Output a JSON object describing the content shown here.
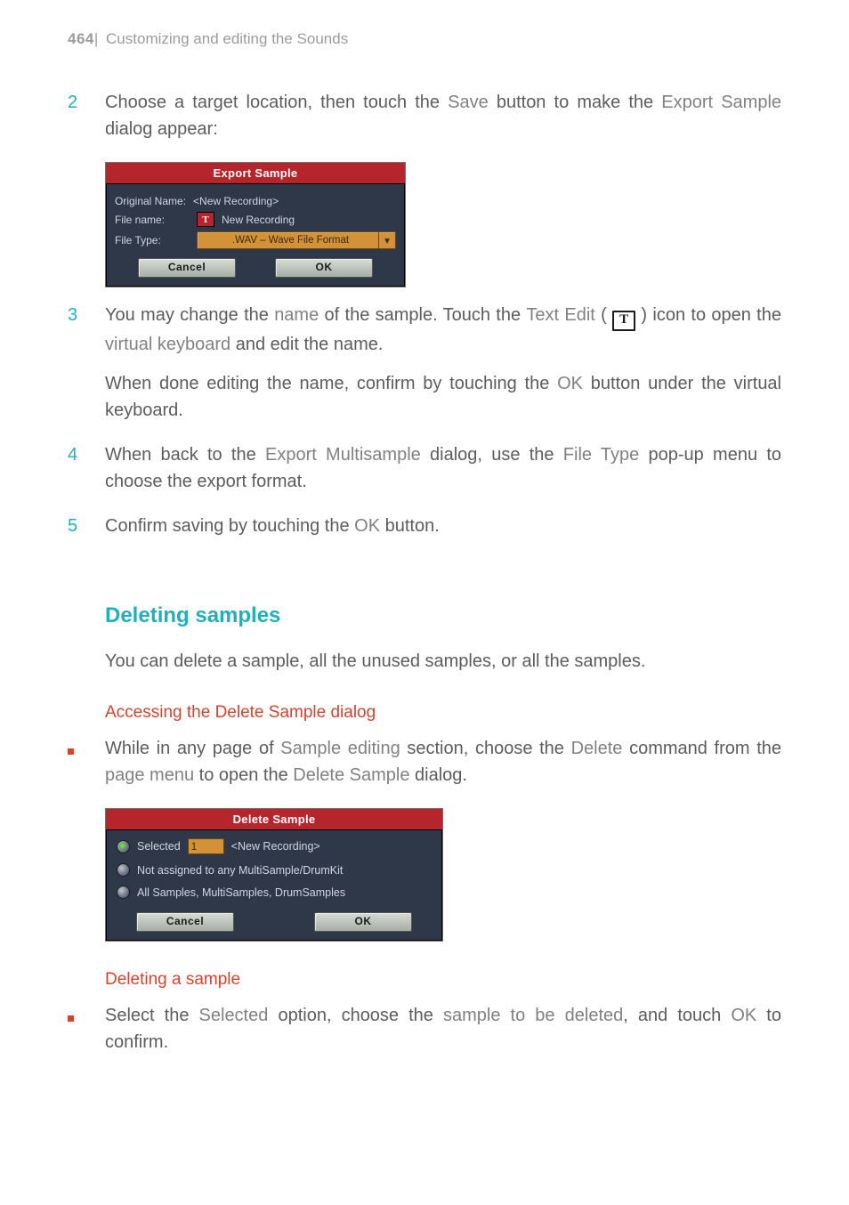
{
  "header": {
    "page_number": "464",
    "chapter_title": "Customizing and editing the Sounds"
  },
  "steps": {
    "s2": {
      "num": "2",
      "p1a": "Choose a target location, then touch the ",
      "save": "Save",
      "p1b": " button to make the ",
      "export_sample": "Export Sample",
      "p1c": " dialog appear:"
    },
    "s3": {
      "num": "3",
      "p1a": "You may change the ",
      "name": "name",
      "p1b": " of the sample. Touch the ",
      "textedit": "Text Edit",
      "p1c": " ( ",
      "iconT": "T",
      "p1d": " ) icon to open the ",
      "vk": "virtual keyboard",
      "p1e": " and edit the name.",
      "p2a": "When done editing the name, confirm by touching the ",
      "ok": "OK",
      "p2b": " button under the virtual keyboard."
    },
    "s4": {
      "num": "4",
      "p1a": "When back to the ",
      "em": "Export Multisample",
      "p1b": " dialog, use the ",
      "ft": "File Type",
      "p1c": " pop-up menu to choose the export format."
    },
    "s5": {
      "num": "5",
      "p1a": "Confirm saving by touching the ",
      "ok": "OK",
      "p1b": " button."
    }
  },
  "h2": "Deleting samples",
  "intro_para": "You can delete a sample, all the unused samples, or all the samples.",
  "h3a": "Accessing the Delete Sample dialog",
  "bullet_a": {
    "p1a": "While in any page of ",
    "se": "Sample editing",
    "p1b": " section, choose the ",
    "del": "Delete",
    "p1c": " command from the ",
    "pm": "page menu",
    "p1d": " to open the ",
    "ds": "Delete Sample",
    "p1e": " dialog."
  },
  "h3b": "Deleting a sample",
  "bullet_b": {
    "p1a": "Select the ",
    "sel": "Selected",
    "p1b": " option, choose the ",
    "std": "sample to be deleted",
    "p1c": ", and touch ",
    "ok": "OK",
    "p1d": " to confirm."
  },
  "dlg_export": {
    "title": "Export Sample",
    "orig_label": "Original Name:",
    "orig_value": "<New Recording>",
    "filename_label": "File name:",
    "filename_value": "New Recording",
    "textedit_icon": "T",
    "filetype_label": "File Type:",
    "filetype_value": ".WAV – Wave File Format",
    "cancel": "Cancel",
    "ok": "OK"
  },
  "dlg_delete": {
    "title": "Delete Sample",
    "opt1_label": "Selected",
    "opt1_num": "1",
    "opt1_name": "<New Recording>",
    "opt2_label": "Not assigned to any MultiSample/DrumKit",
    "opt3_label": "All Samples, MultiSamples, DrumSamples",
    "cancel": "Cancel",
    "ok": "OK"
  },
  "chart_data": {
    "type": "table",
    "title": "Dialog field values shown in screenshot",
    "rows": [
      {
        "dialog": "Export Sample",
        "field": "Original Name",
        "value": "<New Recording>"
      },
      {
        "dialog": "Export Sample",
        "field": "File name",
        "value": "New Recording"
      },
      {
        "dialog": "Export Sample",
        "field": "File Type",
        "value": ".WAV – Wave File Format"
      },
      {
        "dialog": "Delete Sample",
        "field": "Selected index",
        "value": "1"
      },
      {
        "dialog": "Delete Sample",
        "field": "Selected name",
        "value": "<New Recording>"
      }
    ]
  }
}
